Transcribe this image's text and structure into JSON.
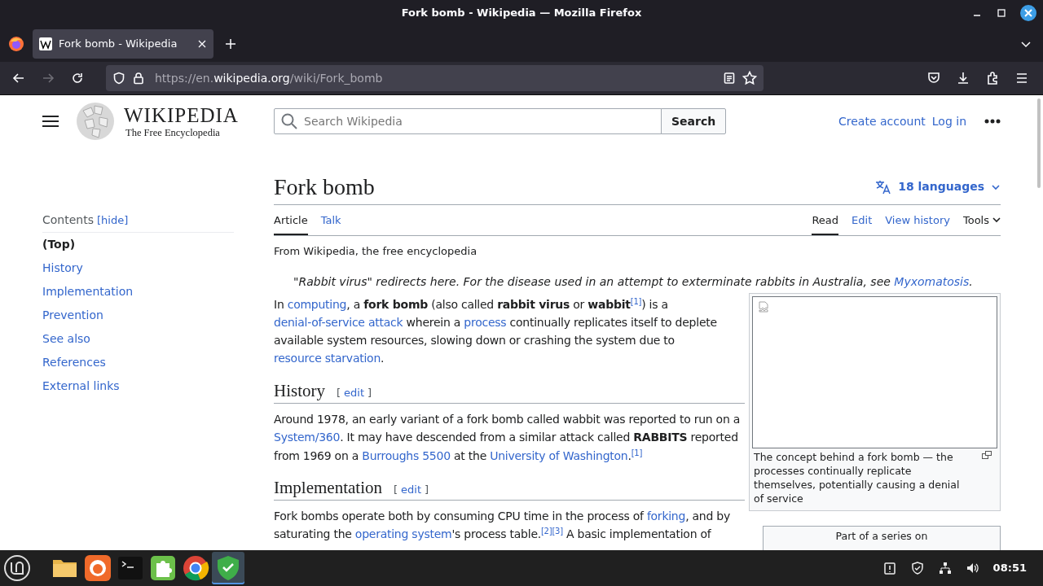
{
  "window": {
    "title": "Fork bomb - Wikipedia — Mozilla Firefox"
  },
  "tabs": [
    {
      "label": "Fork bomb - Wikipedia",
      "selected": true
    }
  ],
  "address_bar": {
    "prefix": "https://en.",
    "domain": "wikipedia.org",
    "path": "/wiki/Fork_bomb"
  },
  "site": {
    "wordmark": "WIKIPEDIA",
    "tagline": "The Free Encyclopedia",
    "search_placeholder": "Search Wikipedia",
    "search_button": "Search",
    "user_links": [
      "Create account",
      "Log in"
    ]
  },
  "toc": {
    "title": "Contents",
    "toggle": "[hide]",
    "items": [
      {
        "label": "(Top)",
        "selected": true
      },
      {
        "label": "History",
        "selected": false
      },
      {
        "label": "Implementation",
        "selected": false
      },
      {
        "label": "Prevention",
        "selected": false
      },
      {
        "label": "See also",
        "selected": false
      },
      {
        "label": "References",
        "selected": false
      },
      {
        "label": "External links",
        "selected": false
      }
    ]
  },
  "article": {
    "title": "Fork bomb",
    "languages": "18 languages",
    "page_tabs": [
      {
        "label": "Article",
        "selected": true
      },
      {
        "label": "Talk",
        "selected": false
      }
    ],
    "view_tabs": [
      {
        "label": "Read",
        "selected": true
      },
      {
        "label": "Edit",
        "selected": false
      },
      {
        "label": "View history",
        "selected": false
      }
    ],
    "tools": "Tools",
    "tagline": "From Wikipedia, the free encyclopedia",
    "hatnote": [
      {
        "kind": "text",
        "text": "\"Rabbit virus\" redirects here. For the disease used in an attempt to exterminate rabbits in Australia, see "
      },
      {
        "kind": "link",
        "text": "Myxomatosis"
      },
      {
        "kind": "text",
        "text": "."
      }
    ],
    "blocks": [
      {
        "kind": "paragraph",
        "runs": [
          {
            "kind": "text",
            "text": "In "
          },
          {
            "kind": "link",
            "text": "computing"
          },
          {
            "kind": "text",
            "text": ", a "
          },
          {
            "kind": "bold",
            "text": "fork bomb"
          },
          {
            "kind": "text",
            "text": " (also called "
          },
          {
            "kind": "bold",
            "text": "rabbit virus"
          },
          {
            "kind": "text",
            "text": " or "
          },
          {
            "kind": "bold",
            "text": "wabbit"
          },
          {
            "kind": "ref",
            "text": "[1]"
          },
          {
            "kind": "text",
            "text": ") is a "
          },
          {
            "kind": "link",
            "text": "denial-of-service attack"
          },
          {
            "kind": "text",
            "text": " wherein a "
          },
          {
            "kind": "link",
            "text": "process"
          },
          {
            "kind": "text",
            "text": " continually replicates itself to deplete available system resources, slowing down or crashing the system due to "
          },
          {
            "kind": "link",
            "text": "resource starvation"
          },
          {
            "kind": "text",
            "text": "."
          }
        ]
      },
      {
        "kind": "heading",
        "text": "History",
        "edit_open": "[",
        "edit": "edit",
        "edit_close": "]"
      },
      {
        "kind": "paragraph",
        "runs": [
          {
            "kind": "text",
            "text": "Around 1978, an early variant of a fork bomb called wabbit was reported to run on a "
          },
          {
            "kind": "link",
            "text": "System/360"
          },
          {
            "kind": "text",
            "text": ". It may have descended from a similar attack called "
          },
          {
            "kind": "bold",
            "text": "RABBITS"
          },
          {
            "kind": "text",
            "text": " reported from 1969 on a "
          },
          {
            "kind": "link",
            "text": "Burroughs 5500"
          },
          {
            "kind": "text",
            "text": " at the "
          },
          {
            "kind": "link",
            "text": "University of Washington"
          },
          {
            "kind": "text",
            "text": "."
          },
          {
            "kind": "ref",
            "text": "[1]"
          }
        ]
      },
      {
        "kind": "heading",
        "text": "Implementation",
        "edit_open": "[",
        "edit": "edit",
        "edit_close": "]"
      },
      {
        "kind": "paragraph",
        "runs": [
          {
            "kind": "text",
            "text": "Fork bombs operate both by consuming CPU time in the process of "
          },
          {
            "kind": "link",
            "text": "forking"
          },
          {
            "kind": "text",
            "text": ", and by saturating the "
          },
          {
            "kind": "link",
            "text": "operating system"
          },
          {
            "kind": "text",
            "text": "'s process table."
          },
          {
            "kind": "ref",
            "text": "[2]"
          },
          {
            "kind": "ref",
            "text": "[3]"
          },
          {
            "kind": "text",
            "text": " A basic implementation of"
          }
        ]
      }
    ],
    "figure": {
      "caption": "The concept behind a fork bomb — the processes continually replicate themselves, potentially causing a denial of service"
    },
    "sidebox": {
      "intro": "Part of a series on"
    }
  },
  "taskbar": {
    "apps": [
      {
        "kind": "folder",
        "active": false
      },
      {
        "kind": "firefox",
        "active": false
      },
      {
        "kind": "terminal",
        "active": false
      },
      {
        "kind": "puzzle",
        "active": false
      },
      {
        "kind": "chrome",
        "active": false
      },
      {
        "kind": "shield",
        "active": true
      }
    ],
    "clock": "08:51"
  }
}
